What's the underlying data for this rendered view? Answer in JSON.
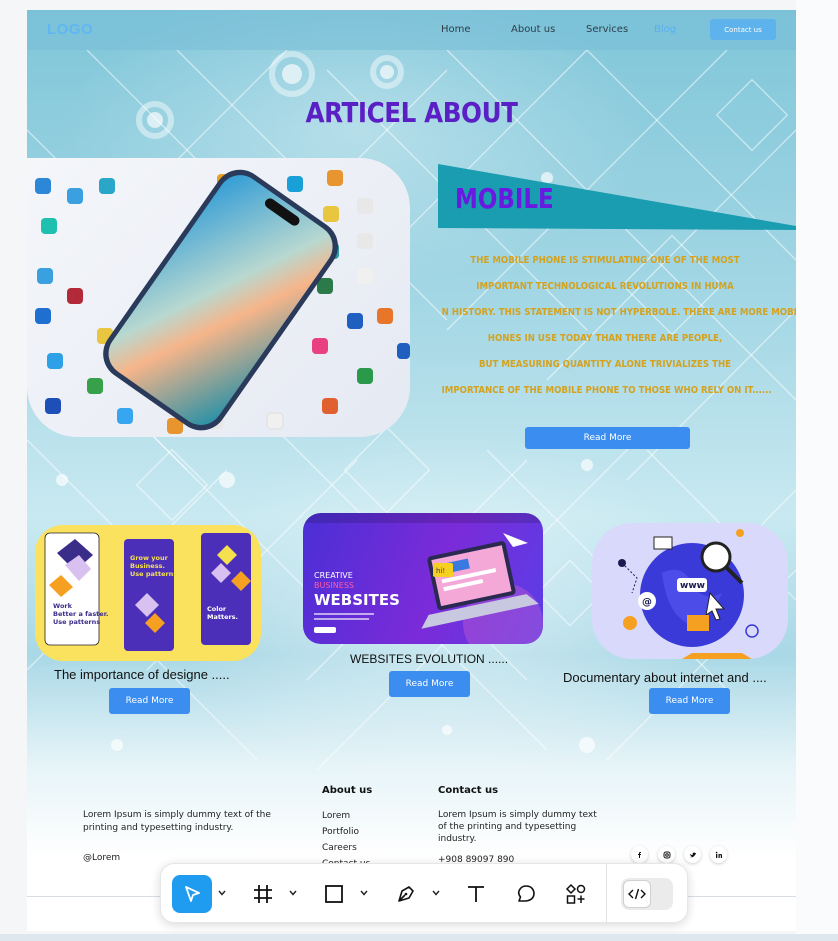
{
  "nav": {
    "logo": "LOGO",
    "links": [
      "Home",
      "About us",
      "Services",
      "Blog"
    ],
    "active": "Blog",
    "contact_label": "Contact us"
  },
  "hero": {
    "title": "ARTICEL ABOUT",
    "subtitle": "MOBILE",
    "paragraph_lines": [
      "THE MOBILE PHONE IS STIMULATING ONE OF THE MOST",
      "IMPORTANT TECHNOLOGICAL REVOLUTIONS IN HUMA",
      "N HISTORY. THIS STATEMENT IS NOT HYPERBOLE. THERE ARE MORE MOBILE P",
      "HONES IN USE TODAY THAN THERE ARE PEOPLE,",
      "BUT MEASURING QUANTITY ALONE TRIVIALIZES THE",
      "IMPORTANCE OF THE MOBILE PHONE TO THOSE WHO RELY ON IT......"
    ],
    "read_more": "Read More"
  },
  "cards": [
    {
      "title": "The importance of designe .....",
      "button": "Read More",
      "image_text": [
        "Work",
        "Better a faster.",
        "Use patterns",
        "Grow your",
        "Business.",
        "Use patterns",
        "Color",
        "Matters."
      ]
    },
    {
      "title": "WEBSITES EVOLUTION ......",
      "button": "Read More",
      "image_text": [
        "CREATIVE",
        "BUSINESS",
        "WEBSITES",
        "hi!"
      ]
    },
    {
      "title": "Documentary about internet and ....",
      "button": "Read More",
      "image_text": [
        "www",
        "@"
      ]
    }
  ],
  "footer": {
    "description": "Lorem Ipsum is simply dummy text of the printing and typesetting industry.",
    "handle": "@Lorem",
    "about_heading": "About us",
    "about_links": [
      "Lorem",
      "Portfolio",
      "Careers",
      "Contact us"
    ],
    "contact_heading": "Contact us",
    "contact_text": "Lorem Ipsum is simply dummy text of the printing and typesetting industry.",
    "phone": "+908 89097 890",
    "social": [
      "f",
      "ig",
      "tw",
      "in"
    ]
  },
  "toolbar": {
    "tools": [
      "move-tool",
      "frame-tool",
      "shape-tool",
      "pen-tool",
      "text-tool",
      "comment-tool",
      "components-tool"
    ],
    "active": "move-tool",
    "dev_mode": "off"
  },
  "colors": {
    "accent_blue": "#3b8df0",
    "title_purple": "#5b1fc6",
    "paragraph_gold": "#d4a21f",
    "toolbar_active": "#1f9cf0"
  }
}
